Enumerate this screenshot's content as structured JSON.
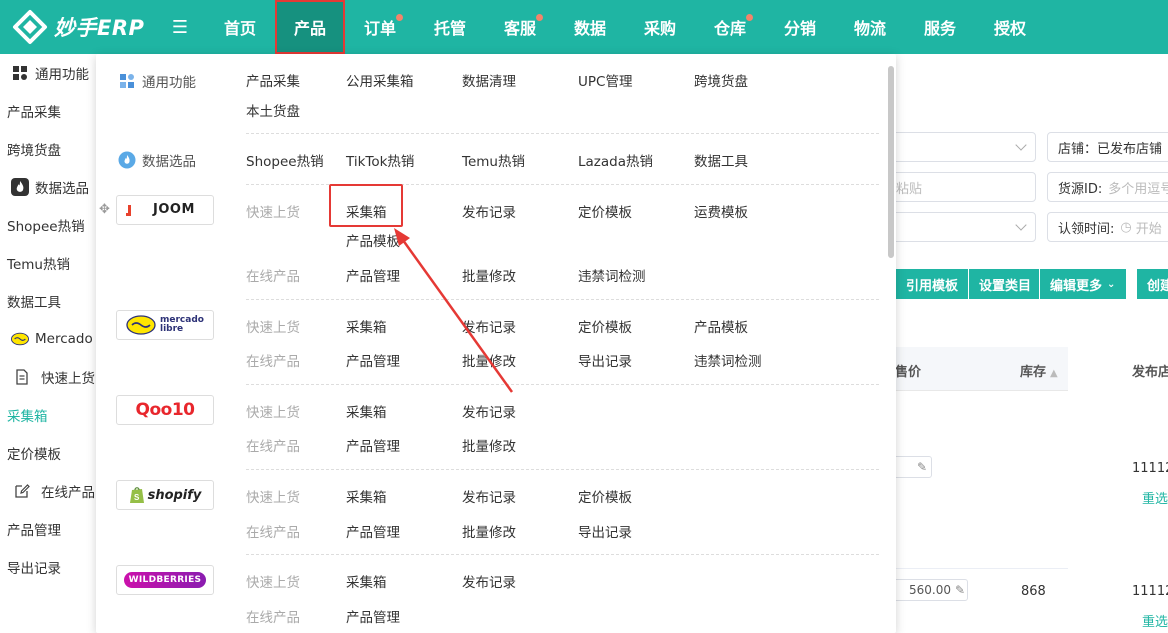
{
  "brand": {
    "name": "妙手ERP"
  },
  "colors": {
    "primary": "#1fb5a3",
    "annotation": "#e53935"
  },
  "nav": {
    "items": [
      {
        "label": "首页",
        "active": false,
        "badge": false
      },
      {
        "label": "产品",
        "active": true,
        "badge": false
      },
      {
        "label": "订单",
        "active": false,
        "badge": true
      },
      {
        "label": "托管",
        "active": false,
        "badge": false
      },
      {
        "label": "客服",
        "active": false,
        "badge": true
      },
      {
        "label": "数据",
        "active": false,
        "badge": false
      },
      {
        "label": "采购",
        "active": false,
        "badge": false
      },
      {
        "label": "仓库",
        "active": false,
        "badge": true
      },
      {
        "label": "分销",
        "active": false,
        "badge": false
      },
      {
        "label": "物流",
        "active": false,
        "badge": false
      },
      {
        "label": "服务",
        "active": false,
        "badge": false
      },
      {
        "label": "授权",
        "active": false,
        "badge": false
      }
    ]
  },
  "sidebar": {
    "general_group": "通用功能",
    "product_collect": "产品采集",
    "cross_border": "跨境货盘",
    "data_group": "数据选品",
    "shopee_hot": "Shopee热销",
    "temu_hot": "Temu热销",
    "data_tools": "数据工具",
    "mercado_group": "Mercado L",
    "quick_listing": "快速上货",
    "collect_box": "采集箱",
    "pricing_template": "定价模板",
    "online_products": "在线产品",
    "product_manage": "产品管理",
    "export_records": "导出记录"
  },
  "background": {
    "shop_field": "店铺：已发布店铺",
    "source_label": "货源ID:",
    "source_placeholder": "多个用逗号",
    "paste_placeholder": "粘贴",
    "claim_label": "认领时间:",
    "claim_placeholder": "开始",
    "buttons": {
      "cite_template": "引用模板",
      "set_category": "设置类目",
      "edit_more": "编辑更多",
      "create": "创建"
    },
    "table_headers": {
      "price": "售价",
      "stock": "库存",
      "publish": "发布店"
    },
    "rows": [
      {
        "shop": "11112",
        "action": "重选"
      },
      {
        "price": "560.00",
        "stock": "868",
        "shop": "11112",
        "action": "重选"
      }
    ]
  },
  "dropdown": {
    "general": {
      "label": "通用功能",
      "items": [
        "产品采集",
        "公用采集箱",
        "数据清理",
        "UPC管理",
        "跨境货盘",
        "本土货盘"
      ]
    },
    "data": {
      "label": "数据选品",
      "items": [
        "Shopee热销",
        "TikTok热销",
        "Temu热销",
        "Lazada热销",
        "数据工具"
      ]
    },
    "platforms": [
      {
        "logo": "JOOM",
        "rows": [
          {
            "label": "快速上货",
            "items": [
              "采集箱",
              "发布记录",
              "定价模板",
              "运费模板",
              "产品模板"
            ]
          },
          {
            "label": "在线产品",
            "items": [
              "产品管理",
              "批量修改",
              "违禁词检测"
            ]
          }
        ]
      },
      {
        "logo": "mercado libre",
        "rows": [
          {
            "label": "快速上货",
            "items": [
              "采集箱",
              "发布记录",
              "定价模板",
              "产品模板"
            ]
          },
          {
            "label": "在线产品",
            "items": [
              "产品管理",
              "批量修改",
              "导出记录",
              "违禁词检测"
            ]
          }
        ]
      },
      {
        "logo": "Qoo10",
        "rows": [
          {
            "label": "快速上货",
            "items": [
              "采集箱",
              "发布记录"
            ]
          },
          {
            "label": "在线产品",
            "items": [
              "产品管理",
              "批量修改"
            ]
          }
        ]
      },
      {
        "logo": "shopify",
        "rows": [
          {
            "label": "快速上货",
            "items": [
              "采集箱",
              "发布记录",
              "定价模板"
            ]
          },
          {
            "label": "在线产品",
            "items": [
              "产品管理",
              "批量修改",
              "导出记录"
            ]
          }
        ]
      },
      {
        "logo": "WILDBERRIES",
        "rows": [
          {
            "label": "快速上货",
            "items": [
              "采集箱",
              "发布记录"
            ]
          },
          {
            "label": "在线产品",
            "items": [
              "产品管理"
            ]
          }
        ]
      }
    ]
  },
  "annotation": {
    "target": "采集箱",
    "icon": "red-arrow-icon"
  }
}
